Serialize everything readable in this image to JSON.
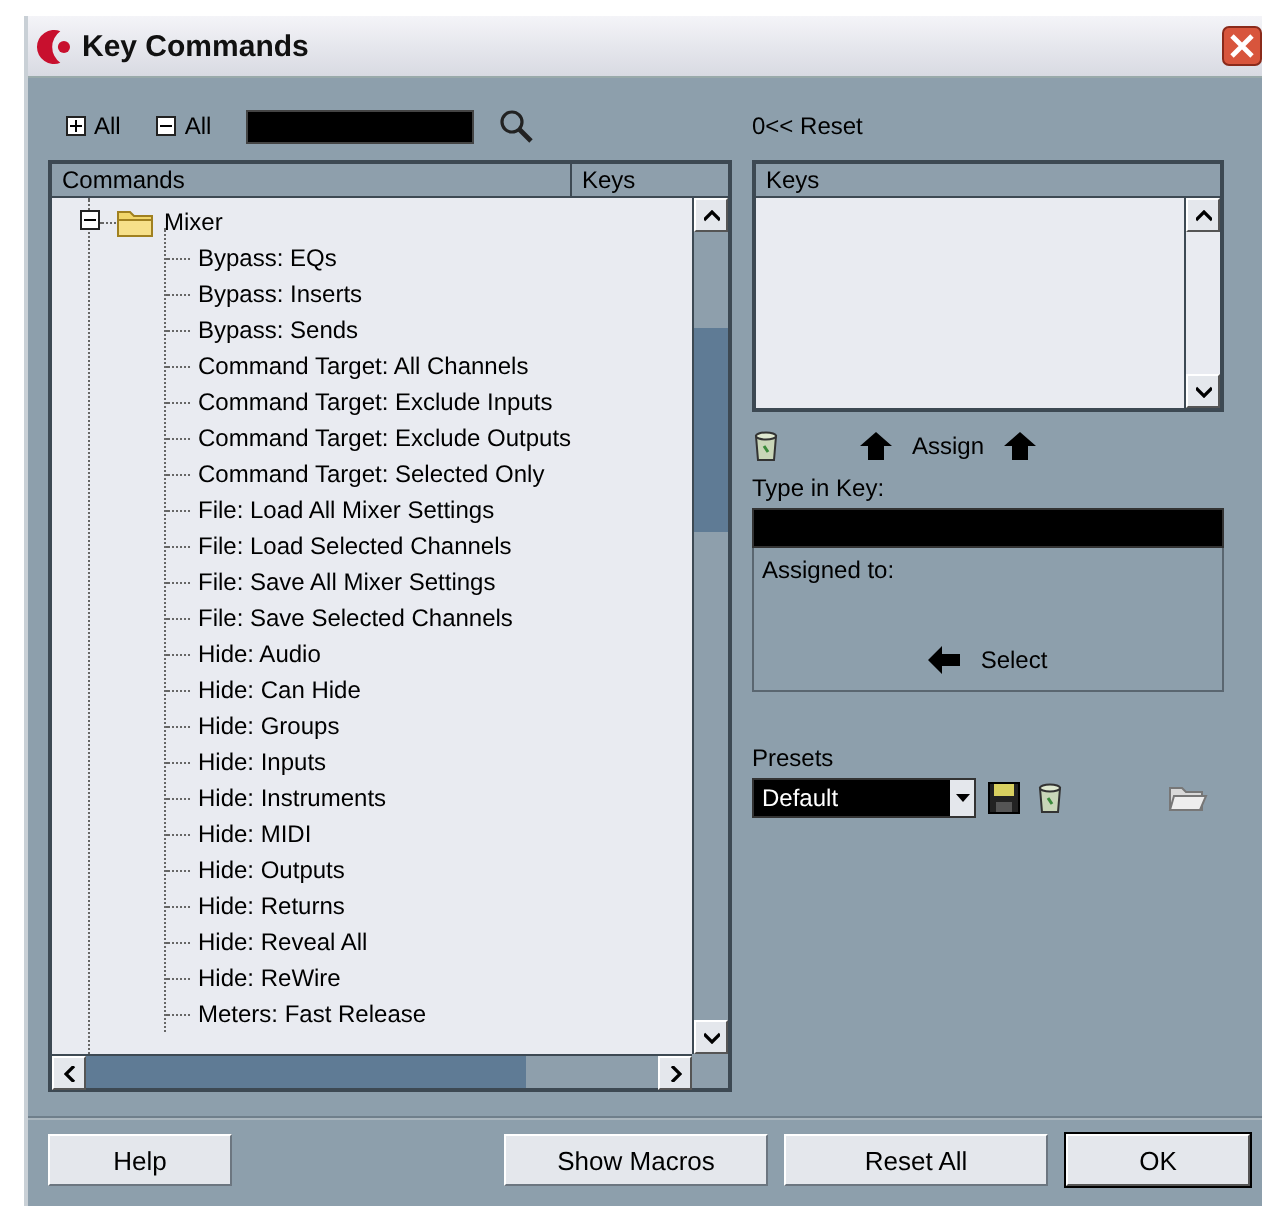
{
  "window": {
    "title": "Key Commands"
  },
  "toolbar": {
    "expand_all": "All",
    "collapse_all": "All"
  },
  "tree": {
    "columns": [
      "Commands",
      "Keys"
    ],
    "items": [
      {
        "label": "Mixer",
        "expanded": true,
        "children": [
          {
            "label": "Bypass: EQs"
          },
          {
            "label": "Bypass: Inserts"
          },
          {
            "label": "Bypass: Sends"
          },
          {
            "label": "Command Target: All Channels"
          },
          {
            "label": "Command Target: Exclude Inputs"
          },
          {
            "label": "Command Target: Exclude Outputs"
          },
          {
            "label": "Command Target: Selected Only"
          },
          {
            "label": "File: Load All Mixer Settings"
          },
          {
            "label": "File: Load Selected Channels"
          },
          {
            "label": "File: Save All Mixer Settings"
          },
          {
            "label": "File: Save Selected Channels"
          },
          {
            "label": "Hide: Audio"
          },
          {
            "label": "Hide: Can Hide"
          },
          {
            "label": "Hide: Groups"
          },
          {
            "label": "Hide: Inputs"
          },
          {
            "label": "Hide: Instruments"
          },
          {
            "label": "Hide: MIDI"
          },
          {
            "label": "Hide: Outputs"
          },
          {
            "label": "Hide: Returns"
          },
          {
            "label": "Hide: Reveal All"
          },
          {
            "label": "Hide: ReWire"
          },
          {
            "label": "Meters: Fast Release"
          }
        ]
      }
    ]
  },
  "right": {
    "reset": "0<< Reset",
    "keys_column": "Keys",
    "assign": "Assign",
    "type_in_key_label": "Type in Key:",
    "assigned_to_label": "Assigned to:",
    "select": "Select",
    "presets_label": "Presets",
    "preset": {
      "value": "Default"
    }
  },
  "buttons": [
    {
      "label": "Help",
      "default": false
    },
    {
      "label": "Show Macros",
      "default": false
    },
    {
      "label": "Reset All",
      "default": false
    },
    {
      "label": "OK",
      "default": true
    }
  ]
}
